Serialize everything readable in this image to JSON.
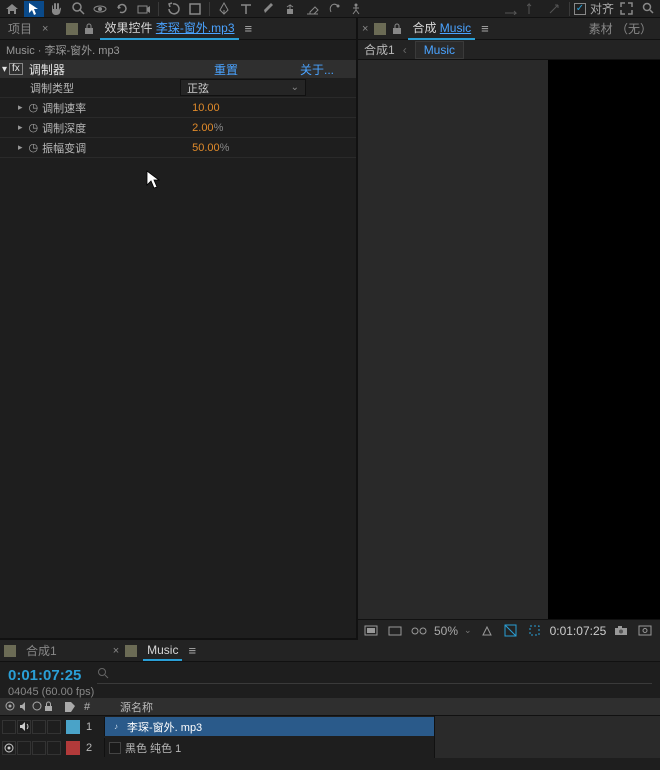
{
  "toolbar": {
    "align_label": "对齐"
  },
  "left_panel": {
    "tabs": {
      "project": "项目",
      "effect_controls_label": "效果控件",
      "media_name": "李琛-窗外.mp3"
    },
    "path": "Music · 李琛-窗外. mp3",
    "effect": {
      "name": "调制器",
      "reset": "重置",
      "about": "关于...",
      "props": [
        {
          "label": "调制类型",
          "type": "dropdown",
          "value": "正弦"
        },
        {
          "label": "调制速率",
          "type": "number",
          "value": "10.00"
        },
        {
          "label": "调制深度",
          "type": "percent",
          "value": "2.00",
          "suffix": "%"
        },
        {
          "label": "振幅变调",
          "type": "percent",
          "value": "50.00",
          "suffix": "%"
        }
      ]
    }
  },
  "right_panel": {
    "tabs": {
      "comp_label": "合成",
      "comp_name": "Music",
      "footage": "素材",
      "none": "（无）"
    },
    "breadcrumb_comp": "合成1",
    "breadcrumb_active": "Music",
    "footer": {
      "zoom": "50%",
      "timecode": "0:01:07:25"
    }
  },
  "timeline": {
    "tabs": {
      "comp1": "合成1",
      "music": "Music"
    },
    "timecode": "0:01:07:25",
    "fps": "04045  (60.00 fps)",
    "columns": {
      "hash": "#",
      "source_name": "源名称"
    },
    "layers": [
      {
        "index": "1",
        "name": "李琛-窗外. mp3",
        "color": "#4aa3c8",
        "type": "audio",
        "selected": true
      },
      {
        "index": "2",
        "name": "黑色 纯色 1",
        "color": "#b23a3a",
        "solid": "#1a1a1a",
        "type": "solid",
        "selected": false
      }
    ]
  }
}
